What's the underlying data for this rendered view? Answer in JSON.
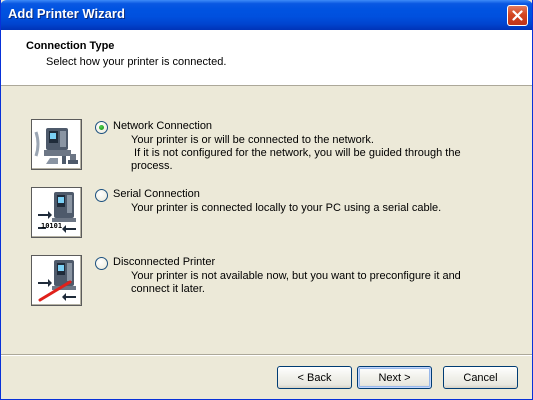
{
  "window": {
    "title": "Add Printer Wizard",
    "title_bar_color": "#0054E3",
    "face_color": "#ECE9D8"
  },
  "header": {
    "title": "Connection Type",
    "subtitle": "Select how your printer is connected."
  },
  "options": [
    {
      "label": "Network Connection",
      "selected": true,
      "icon": "network-printer-icon",
      "description_lines": [
        "Your printer is or will be connected to the network.",
        " If it is not configured for the network, you will be guided through the",
        "process."
      ]
    },
    {
      "label": "Serial Connection",
      "selected": false,
      "icon": "serial-printer-icon",
      "description_lines": [
        "Your printer is connected locally to your PC using a serial cable."
      ]
    },
    {
      "label": "Disconnected Printer",
      "selected": false,
      "icon": "disconnected-printer-icon",
      "description_lines": [
        "Your printer is not available now, but you want to preconfigure it and",
        "connect it later."
      ]
    }
  ],
  "serial_icon_text": "10101",
  "buttons": {
    "back": "< Back",
    "next": "Next >",
    "cancel": "Cancel"
  }
}
